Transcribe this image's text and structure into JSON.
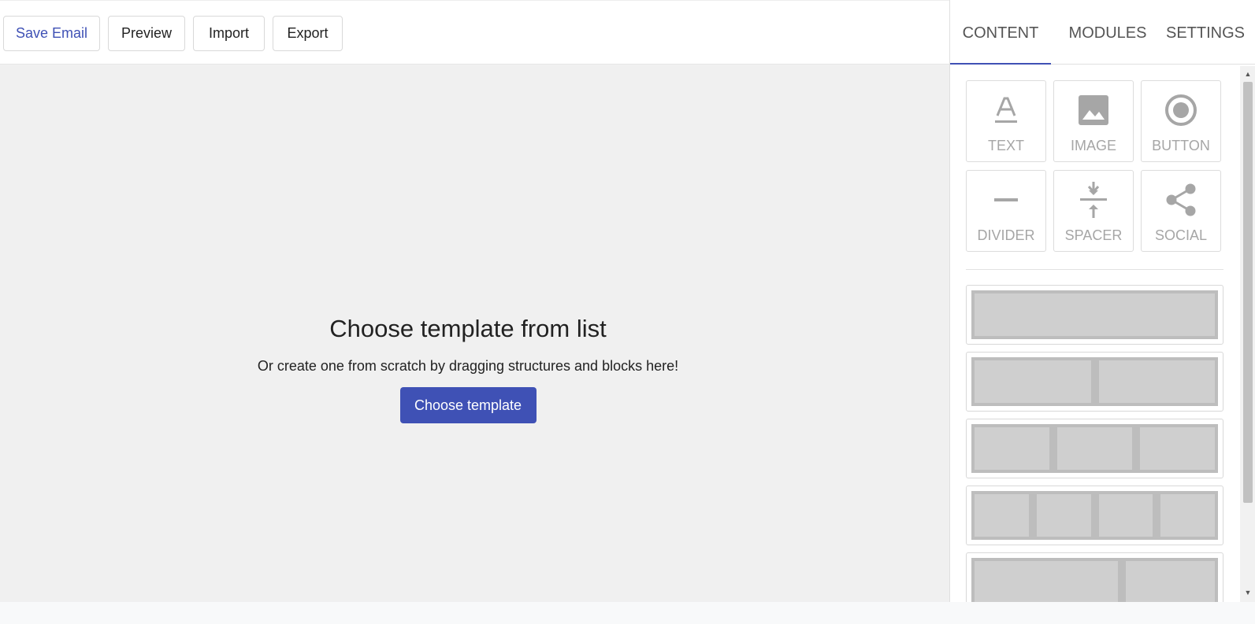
{
  "toolbar": {
    "save_label": "Save Email",
    "preview_label": "Preview",
    "import_label": "Import",
    "export_label": "Export"
  },
  "canvas": {
    "title": "Choose template from list",
    "subtitle": "Or create one from scratch by dragging structures and blocks here!",
    "choose_button": "Choose template"
  },
  "panel": {
    "tabs": [
      {
        "label": "CONTENT",
        "active": true
      },
      {
        "label": "MODULES",
        "active": false
      },
      {
        "label": "SETTINGS",
        "active": false
      }
    ],
    "blocks": [
      {
        "label": "TEXT",
        "icon": "text-icon"
      },
      {
        "label": "IMAGE",
        "icon": "image-icon"
      },
      {
        "label": "BUTTON",
        "icon": "button-icon"
      },
      {
        "label": "DIVIDER",
        "icon": "divider-icon"
      },
      {
        "label": "SPACER",
        "icon": "spacer-icon"
      },
      {
        "label": "SOCIAL",
        "icon": "share-icon"
      }
    ],
    "structures": [
      {
        "columns": 1
      },
      {
        "columns": 2
      },
      {
        "columns": 3
      },
      {
        "columns": 4
      },
      {
        "columns": 2
      }
    ]
  },
  "colors": {
    "accent": "#3f51b5",
    "canvas_bg": "#f0f0f0",
    "icon_grey": "#a6a6a6"
  }
}
